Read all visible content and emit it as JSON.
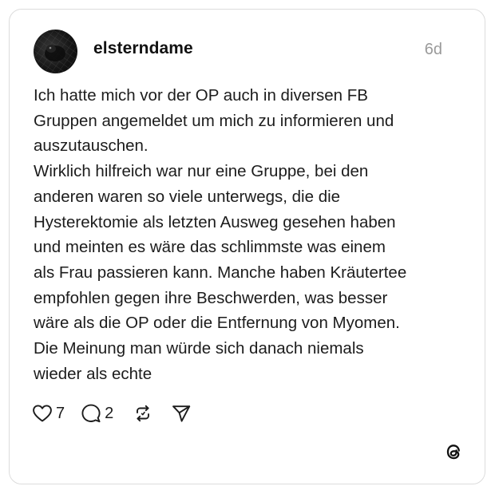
{
  "post": {
    "username": "elsterndame",
    "timestamp": "6d",
    "text_lines": [
      "Ich hatte mich vor der OP auch in diversen FB",
      "Gruppen angemeldet um mich zu informieren und",
      "auszutauschen.",
      "Wirklich hilfreich war nur eine Gruppe, bei den",
      "anderen waren so viele unterwegs, die die",
      "Hysterektomie als letzten Ausweg gesehen haben",
      "und meinten es wäre das schlimmste was einem",
      "als Frau passieren kann. Manche haben Kräutertee",
      "empfohlen gegen ihre Beschwerden, was besser",
      "wäre als die OP oder die Entfernung von Myomen.",
      "Die Meinung man würde sich danach niemals",
      "wieder als echte"
    ]
  },
  "actions": {
    "likes": "7",
    "replies": "2"
  },
  "icons": {
    "like": "heart-icon",
    "reply": "comment-icon",
    "repost": "repost-icon",
    "share": "send-icon",
    "brand": "threads-logo-icon"
  },
  "colors": {
    "card_border": "#dcdcdc",
    "timestamp": "#9a9a9a",
    "text": "#1c1c1c"
  }
}
